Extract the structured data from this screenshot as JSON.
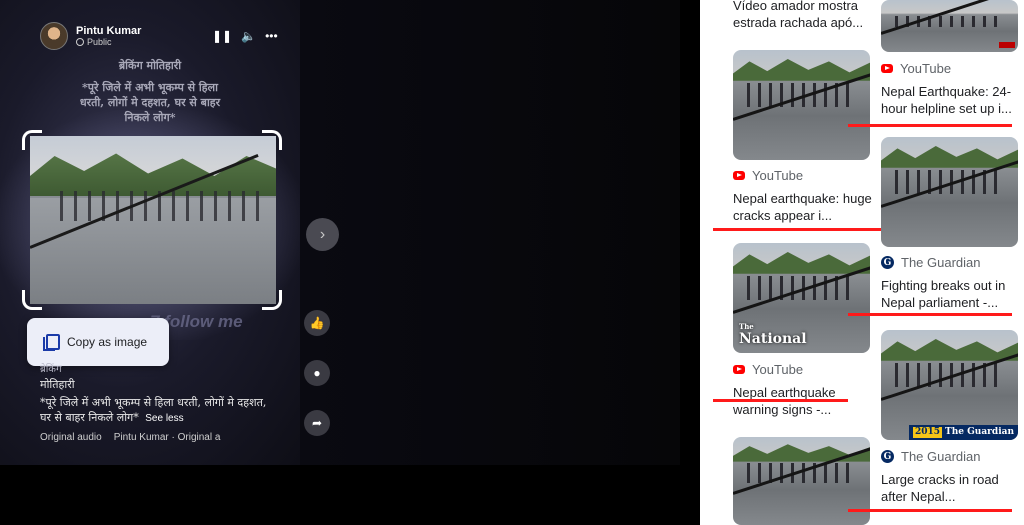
{
  "post": {
    "author_name": "Pintu Kumar",
    "privacy": "Public",
    "overlay_title": "ब्रेकिंग मोतिहारी",
    "overlay_quote": "*पूरे जिले में अभी भूकम्प से हिला धरती, लोगों मे दहशत, घर से बाहर निकले लोग*",
    "watermark_text": "7 follow me",
    "caption_small": "ब्रेकिंग",
    "caption_place": "मोतिहारी",
    "caption_text": "*पूरे जिले में अभी भूकम्प से हिला धरती, लोगों मे दहशत, घर से बाहर निकले लोग*",
    "see_less": "See less",
    "audio_label": "Original audio",
    "audio_credit": "Pintu Kumar · Original a"
  },
  "controls": {
    "pause_icon": "pause-icon",
    "volume_icon": "volume-icon",
    "more_icon": "more-icon",
    "pause_glyph": "❚❚",
    "volume_glyph": "🔈",
    "more_glyph": "•••"
  },
  "popup": {
    "copy_label": "Copy as image"
  },
  "side_actions": {
    "like_glyph": "👍",
    "comment_glyph": "●",
    "share_glyph": "➦",
    "next_glyph": "›"
  },
  "results": [
    {
      "source": "",
      "title": "Vídeo amador mostra estrada rachada apó..."
    },
    {
      "source": "YouTube",
      "title": "Nepal Earthquake: 24-hour helpline set up i..."
    },
    {
      "source": "YouTube",
      "title": "Nepal earthquake: huge cracks appear i..."
    },
    {
      "source": "The Guardian",
      "title": "Fighting breaks out in Nepal parliament -..."
    },
    {
      "source": "YouTube",
      "title": "Nepal earthquake warning signs -..."
    },
    {
      "source": "The Guardian",
      "title": "Large cracks in road after Nepal..."
    }
  ],
  "thumb_labels": {
    "national_small": "The",
    "national": "National",
    "guardian_year": "2015",
    "guardian_name": "The Guardian"
  },
  "colors": {
    "highlight_line": "#ff1a1a",
    "youtube_red": "#ff0000",
    "guardian_blue": "#052962"
  }
}
